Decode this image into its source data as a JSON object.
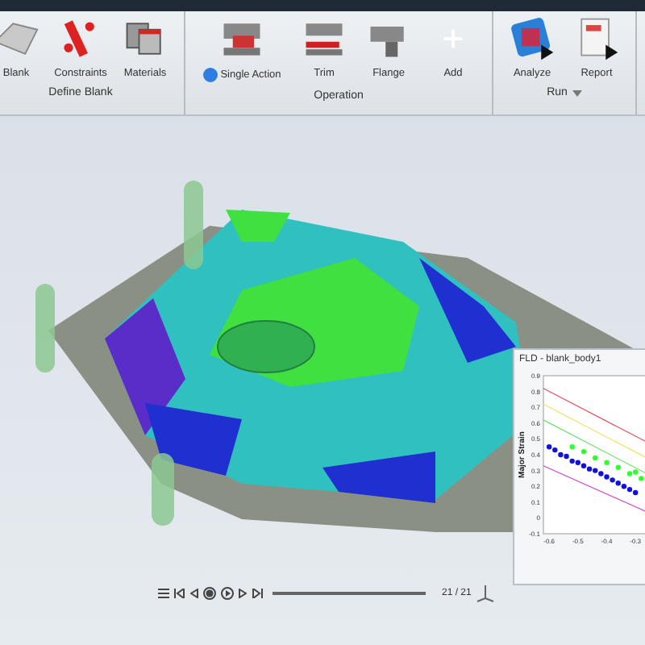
{
  "ribbon": {
    "groups": [
      {
        "label": "Define Blank",
        "tools": [
          {
            "label": "Blank"
          },
          {
            "label": "Constraints"
          },
          {
            "label": "Materials"
          }
        ]
      },
      {
        "label": "Operation",
        "tools": [
          {
            "label": "Single Action",
            "checked": true
          },
          {
            "label": "Trim"
          },
          {
            "label": "Flange"
          },
          {
            "label": "Add"
          }
        ]
      },
      {
        "label": "Run",
        "dropdown": true,
        "tools": [
          {
            "label": "Analyze"
          },
          {
            "label": "Report"
          }
        ]
      }
    ]
  },
  "fld_panel": {
    "title": "FLD - blank_body1",
    "chart_data": {
      "type": "scatter",
      "ylabel": "Major Strain",
      "xlim": [
        -0.62,
        -0.25
      ],
      "ylim": [
        -0.1,
        0.9
      ],
      "xticks": [
        -0.6,
        -0.5,
        -0.4,
        -0.3
      ],
      "yticks": [
        -0.1,
        0,
        0.1,
        0.2,
        0.3,
        0.4,
        0.5,
        0.6,
        0.7,
        0.8,
        0.9
      ],
      "x": [
        -0.52,
        -0.48,
        -0.44,
        -0.4,
        -0.36,
        -0.32,
        -0.28,
        -0.3,
        -0.6,
        -0.58,
        -0.56,
        -0.54,
        -0.52,
        -0.5,
        -0.48,
        -0.46,
        -0.44,
        -0.42,
        -0.4,
        -0.38,
        -0.36,
        -0.34,
        -0.32,
        -0.3
      ],
      "series": [
        {
          "color": "#30ff30",
          "values": [
            0.45,
            0.42,
            0.38,
            0.35,
            0.32,
            0.28,
            0.25,
            0.29,
            null,
            null,
            null,
            null,
            null,
            null,
            null,
            null,
            null,
            null,
            null,
            null,
            null,
            null,
            null,
            null
          ]
        },
        {
          "color": "#1010e0",
          "values": [
            null,
            null,
            null,
            null,
            null,
            null,
            null,
            null,
            0.45,
            0.43,
            0.4,
            0.39,
            0.36,
            0.35,
            0.33,
            0.31,
            0.3,
            0.28,
            0.26,
            0.24,
            0.22,
            0.2,
            0.18,
            0.16
          ]
        }
      ]
    },
    "curves": {
      "chart_data": {
        "type": "line",
        "xlim": [
          -0.62,
          -0.25
        ],
        "ylim": [
          -0.1,
          0.9
        ],
        "x": [
          -0.62,
          -0.25
        ],
        "series": [
          {
            "color": "#e05060",
            "values": [
              0.82,
              0.47
            ]
          },
          {
            "color": "#f0e070",
            "values": [
              0.72,
              0.37
            ]
          },
          {
            "color": "#70e070",
            "values": [
              0.62,
              0.27
            ]
          },
          {
            "color": "#d040d0",
            "values": [
              0.33,
              0.03
            ]
          }
        ]
      }
    }
  },
  "playback": {
    "counter": "21 / 21",
    "level": 1
  }
}
